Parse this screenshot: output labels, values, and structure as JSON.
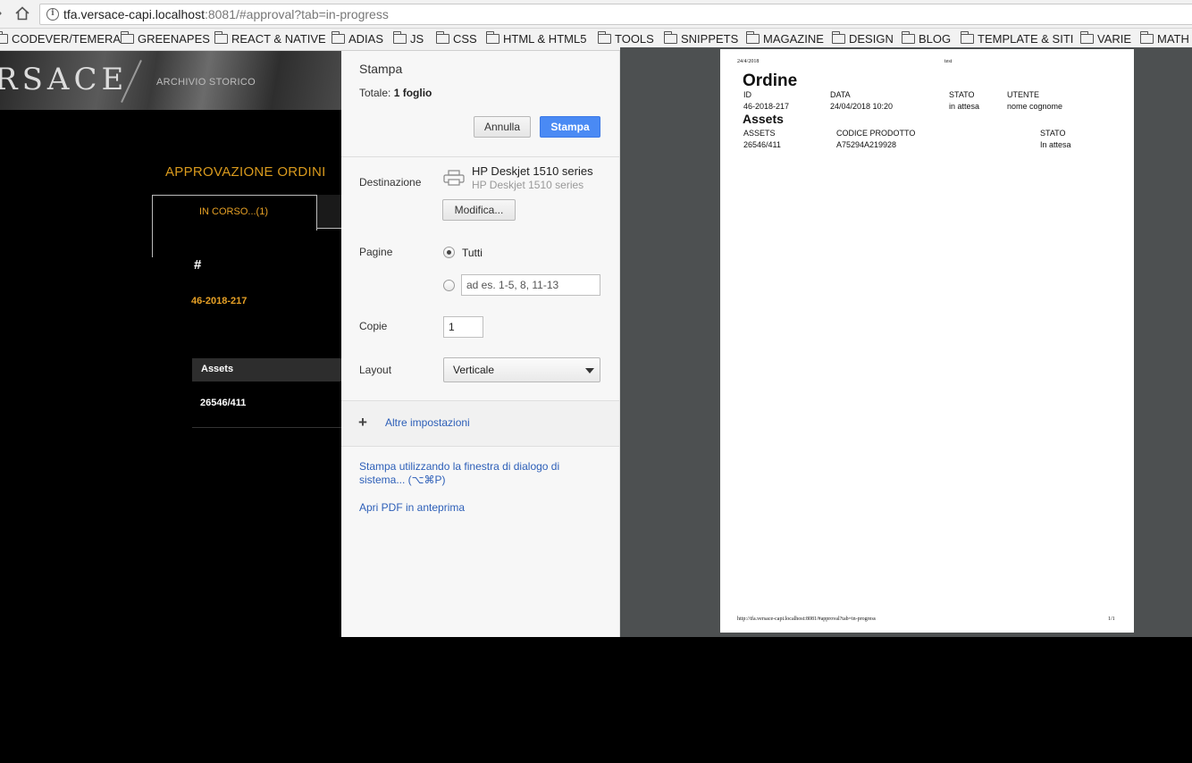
{
  "browser": {
    "url_host": "tfa.versace-capi.localhost",
    "url_rest": ":8081/#approval?tab=in-progress",
    "info_glyph": "i",
    "bookmarks": [
      "CODEVER/TEMERA",
      "GREENAPES",
      "REACT & NATIVE",
      "ADIAS",
      "JS",
      "CSS",
      "HTML & HTML5",
      "TOOLS",
      "SNIPPETS",
      "MAGAZINE",
      "DESIGN",
      "BLOG",
      "TEMPLATE & SITI",
      "VARIE",
      "MATH"
    ]
  },
  "site": {
    "brand": "RSACE",
    "archive": "ARCHIVIO STORICO",
    "page_title": "APPROVAZIONE ORDINI",
    "tab_in_progress": "IN CORSO...(1)",
    "col_hash": "#",
    "order_id": "46-2018-217",
    "assets_header": "Assets",
    "asset_value": "26546/411"
  },
  "print_dialog": {
    "title": "Stampa",
    "total_label": "Totale:",
    "total_value": "1 foglio",
    "cancel": "Annulla",
    "print": "Stampa",
    "destination_label": "Destinazione",
    "printer_name": "HP Deskjet 1510 series",
    "printer_sub": "HP Deskjet 1510 series",
    "modify": "Modifica...",
    "pages_label": "Pagine",
    "pages_all": "Tutti",
    "pages_placeholder": "ad es. 1-5, 8, 11-13",
    "copies_label": "Copie",
    "copies_value": "1",
    "layout_label": "Layout",
    "layout_value": "Verticale",
    "more_settings": "Altre impostazioni",
    "system_dialog_line1": "Stampa utilizzando la finestra di dialogo di",
    "system_dialog_line2": "sistema... (⌥⌘P)",
    "open_pdf": "Apri PDF in anteprima"
  },
  "preview": {
    "date": "24/4/2018",
    "header_title": "test",
    "title": "Ordine",
    "col_id": "ID",
    "col_data": "DATA",
    "col_stato": "STATO",
    "col_utente": "UTENTE",
    "id": "46-2018-217",
    "data": "24/04/2018 10:20",
    "stato": "in attesa",
    "utente": "nome cognome",
    "assets_title": "Assets",
    "col_assets": "ASSETS",
    "col_codice": "CODICE PRODOTTO",
    "col_stato2": "STATO",
    "asset": "26546/411",
    "codice": "A75294A219928",
    "asset_stato": "In attesa",
    "footer_url": "http://tfa.versace-capi.localhost:8081/#approval?tab=in-progress",
    "page_num": "1/1"
  }
}
